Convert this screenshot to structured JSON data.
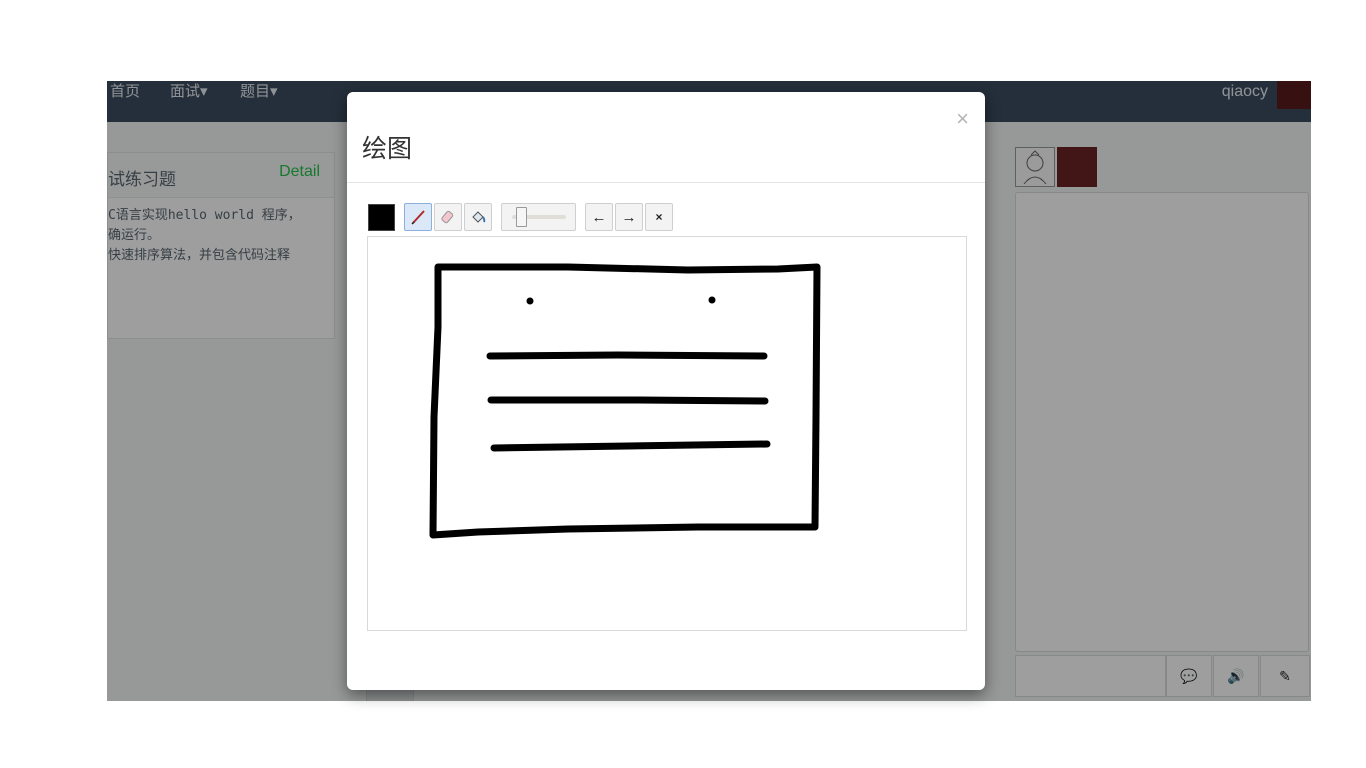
{
  "navbar": {
    "items": [
      {
        "label": "首页"
      },
      {
        "label": "面试▾"
      },
      {
        "label": "题目▾"
      }
    ],
    "username": "qiaocy"
  },
  "panel": {
    "title": "试练习题",
    "detail_link": "Detail",
    "lines": [
      "C语言实现hello world 程序，",
      "确运行。",
      "快速排序算法，并包含代码注释"
    ]
  },
  "chat": {
    "buttons": [
      {
        "icon": "chat-bubble-icon",
        "glyph": "💬"
      },
      {
        "icon": "speaker-icon",
        "glyph": "🔊"
      },
      {
        "icon": "edit-icon",
        "glyph": "✎"
      }
    ]
  },
  "modal": {
    "title": "绘图",
    "close_label": "×",
    "toolbar": {
      "color": "#000000",
      "undo_label": "←",
      "redo_label": "→",
      "clear_label": "×",
      "active_tool": "pencil"
    }
  },
  "colors": {
    "navbar_bg": "#3a4d5f",
    "accent_green": "#27c24c",
    "backdrop": "rgba(0,0,0,0.38)"
  }
}
